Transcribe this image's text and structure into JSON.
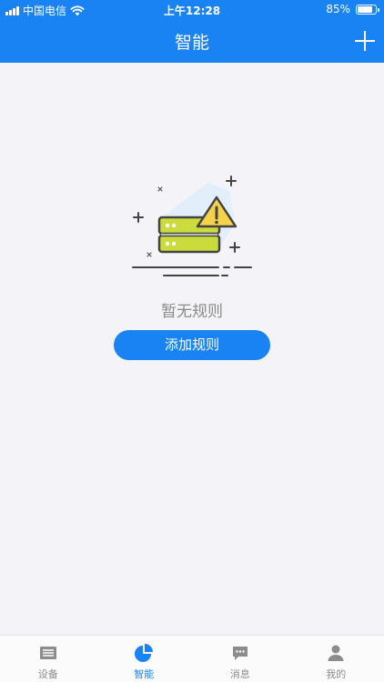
{
  "status_bar": {
    "carrier": "中国电信",
    "time": "上午12:28",
    "battery_percent": "85%",
    "battery_level": 0.85
  },
  "header": {
    "title": "智能"
  },
  "empty_state": {
    "message": "暂无规则",
    "button_label": "添加规则"
  },
  "tabs": [
    {
      "label": "设备",
      "icon": "device-list-icon",
      "active": false
    },
    {
      "label": "智能",
      "icon": "pie-chart-icon",
      "active": true
    },
    {
      "label": "消息",
      "icon": "message-icon",
      "active": false
    },
    {
      "label": "我的",
      "icon": "person-icon",
      "active": false
    }
  ],
  "colors": {
    "primary": "#1a83f4",
    "background": "#f4f4f8",
    "server_green": "#c9dc3c",
    "warning_yellow": "#f6d24a",
    "inactive_tab": "#8c8c8c"
  }
}
